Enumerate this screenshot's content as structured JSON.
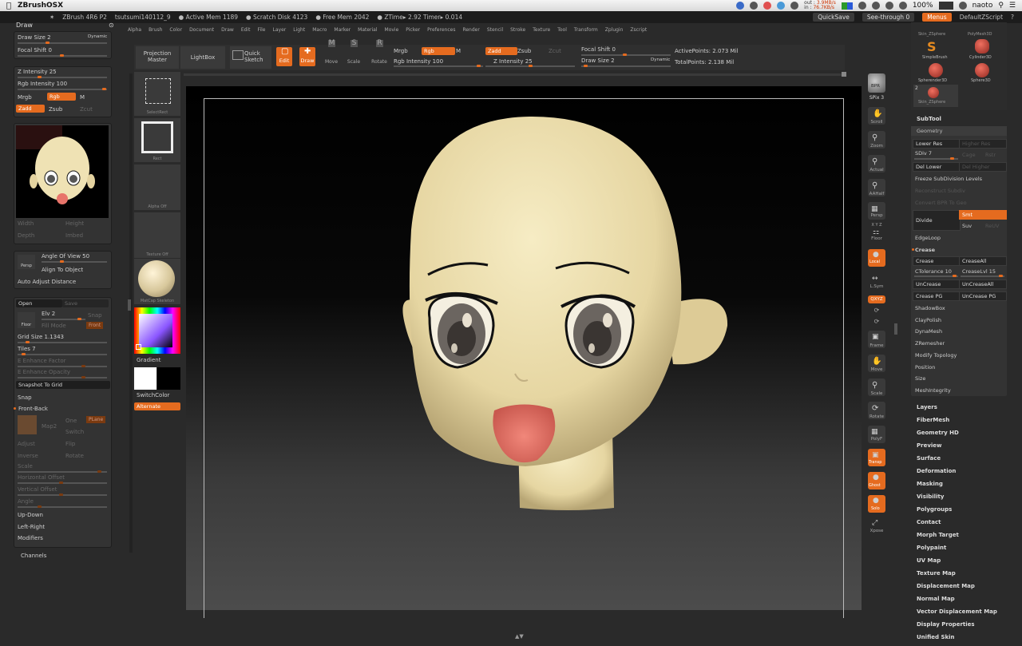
{
  "macbar": {
    "app_name": "ZBrushOSX",
    "net_out_label": "out :",
    "net_out_val": "3.9MB/s",
    "net_in_label": "in :",
    "net_in_val": "76.7KB/s",
    "battery": "100%",
    "user": "naoto"
  },
  "ztitle": {
    "version": "ZBrush 4R6 P2",
    "doc": "tsutsumi140112_9",
    "active_mem": "● Active Mem 1189",
    "scratch": "● Scratch Disk 4123",
    "free_mem": "● Free Mem 2042",
    "ztime": "● ZTime▸ 2.92 Timer▸ 0.014",
    "quicksave": "QuickSave",
    "seethrough": "See-through  0",
    "menus": "Menus",
    "script": "DefaultZScript"
  },
  "menus": [
    "Alpha",
    "Brush",
    "Color",
    "Document",
    "Draw",
    "Edit",
    "File",
    "Layer",
    "Light",
    "Macro",
    "Marker",
    "Material",
    "Movie",
    "Picker",
    "Preferences",
    "Render",
    "Stencil",
    "Stroke",
    "Texture",
    "Tool",
    "Transform",
    "Zplugin",
    "Zscript"
  ],
  "left": {
    "draw_header": "Draw",
    "draw_size": "Draw Size 2",
    "dynamic": "Dynamic",
    "focal_shift": "Focal Shift 0",
    "z_intensity": "Z Intensity 25",
    "rgb_intensity": "Rgb Intensity 100",
    "mrgb": "Mrgb",
    "rgb": "Rgb",
    "m": "M",
    "zadd": "Zadd",
    "zsub": "Zsub",
    "zcut": "Zcut",
    "width": "Width",
    "height": "Height",
    "depth": "Depth",
    "imbed": "Imbed",
    "persp": "Persp",
    "angle_of_view": "Angle Of View 50",
    "align_to_object": "Align To Object",
    "auto_adjust": "Auto Adjust Distance",
    "open": "Open",
    "save": "Save",
    "floor": "Floor",
    "elv": "Elv 2",
    "snap": "Snap",
    "fill_mode": "Fill Mode",
    "front": "Front",
    "grid_size": "Grid Size 1.1343",
    "tiles": "Tiles 7",
    "e_enh_factor": "E Enhance Factor",
    "e_enh_opacity": "E Enhance Opacity",
    "snapshot": "Snapshot To Grid",
    "snap2": "Snap",
    "front_back": "Front-Back",
    "one": "One",
    "plane": "PLane",
    "map2": "Map2",
    "switch": "Switch",
    "adjust": "Adjust",
    "flip": "Flip",
    "inverse": "Inverse",
    "rotate": "Rotate",
    "scale": "Scale",
    "h_offset": "Horizontal Offset",
    "v_offset": "Vertical Offset",
    "angle": "Angle",
    "up_down": "Up-Down",
    "left_right": "Left-Right",
    "modifiers": "Modifiers",
    "channels": "Channels"
  },
  "toolbar": {
    "projection_master": "Projection Master",
    "lightbox": "LightBox",
    "quick_sketch": "Quick Sketch",
    "edit": "Edit",
    "draw": "Draw",
    "move": "Move",
    "scale": "Scale",
    "rotate": "Rotate",
    "mrgb": "Mrgb",
    "rgb": "Rgb",
    "m": "M",
    "rgb_intensity": "Rgb Intensity 100",
    "zadd": "Zadd",
    "zsub": "Zsub",
    "zcut": "Zcut",
    "z_intensity": "Z Intensity 25",
    "focal_shift": "Focal Shift 0",
    "draw_size": "Draw Size 2",
    "dynamic": "Dynamic",
    "active_points": "ActivePoints: 2.073 Mil",
    "total_points": "TotalPoints: 2.138 Mil"
  },
  "shelf": {
    "select_rect": "SelectRect",
    "rect": "Rect",
    "alpha_off": "Alpha Off",
    "texture_off": "Texture Off",
    "matcap": "MatCap Skeleton",
    "gradient": "Gradient",
    "switch_color": "SwitchColor",
    "alternate": "Alternate"
  },
  "rshelf": {
    "bpr": "BPR",
    "spix": "SPix 3",
    "scroll": "Scroll",
    "zoom": "Zoom",
    "actual": "Actual",
    "aahalf": "AAHalf",
    "persp": "Persp",
    "xyz_axes": "X Y Z",
    "floor": "Floor",
    "local": "Local",
    "lsym": "L.Sym",
    "qxyz": "QXYZ",
    "frame": "Frame",
    "move": "Move",
    "scale": "Scale",
    "rotate": "Rotate",
    "polyf": "PolyF",
    "transp": "Transp",
    "ghost": "Ghost",
    "solo": "Solo",
    "xpose": "Xpose"
  },
  "tools": {
    "skin_zsphere": "Skin_ZSphere",
    "polymesh3d": "PolyMesh3D",
    "simplebrush": "SimpleBrush",
    "cylinder3d": "Cylinder3D",
    "spherender3d": "Spherender3D",
    "sphere3d": "Sphere3D",
    "skin_zsphere2": "Skin_ZSphere",
    "count_badge": "2"
  },
  "geometry": {
    "subtool": "SubTool",
    "geometry": "Geometry",
    "lower_res": "Lower Res",
    "higher_res": "Higher Res",
    "sdiv": "SDiv 7",
    "cage": "Cage",
    "rstr": "Rstr",
    "del_lower": "Del Lower",
    "del_higher": "Del Higher",
    "freeze": "Freeze SubDivision Levels",
    "reconstruct": "Reconstruct Subdiv",
    "convert_bpr": "Convert BPR To Geo",
    "divide": "Divide",
    "smt": "Smt",
    "suv": "Suv",
    "reuv": "ReUV",
    "edgeloop": "EdgeLoop",
    "crease_hdr": "Crease",
    "crease": "Crease",
    "crease_all": "CreaseAll",
    "ctolerance": "CTolerance 10",
    "crease_lvl": "CreaseLvl 15",
    "uncrease": "UnCrease",
    "uncrease_all": "UnCreaseAll",
    "crease_pg": "Crease PG",
    "uncrease_pg": "UnCrease PG",
    "shadowbox": "ShadowBox",
    "claypolish": "ClayPolish",
    "dynamesh": "DynaMesh",
    "zremesher": "ZRemesher",
    "modify_topology": "Modify Topology",
    "position": "Position",
    "size": "Size",
    "meshintegrity": "MeshIntegrity"
  },
  "sections": [
    "Layers",
    "FiberMesh",
    "Geometry HD",
    "Preview",
    "Surface",
    "Deformation",
    "Masking",
    "Visibility",
    "Polygroups",
    "Contact",
    "Morph Target",
    "Polypaint",
    "UV Map",
    "Texture Map",
    "Displacement Map",
    "Normal Map",
    "Vector Displacement Map",
    "Display Properties",
    "Unified Skin"
  ],
  "colors": {
    "accent": "#e56b1f",
    "skin": "#efe2b4",
    "mouth": "#e8746a"
  }
}
